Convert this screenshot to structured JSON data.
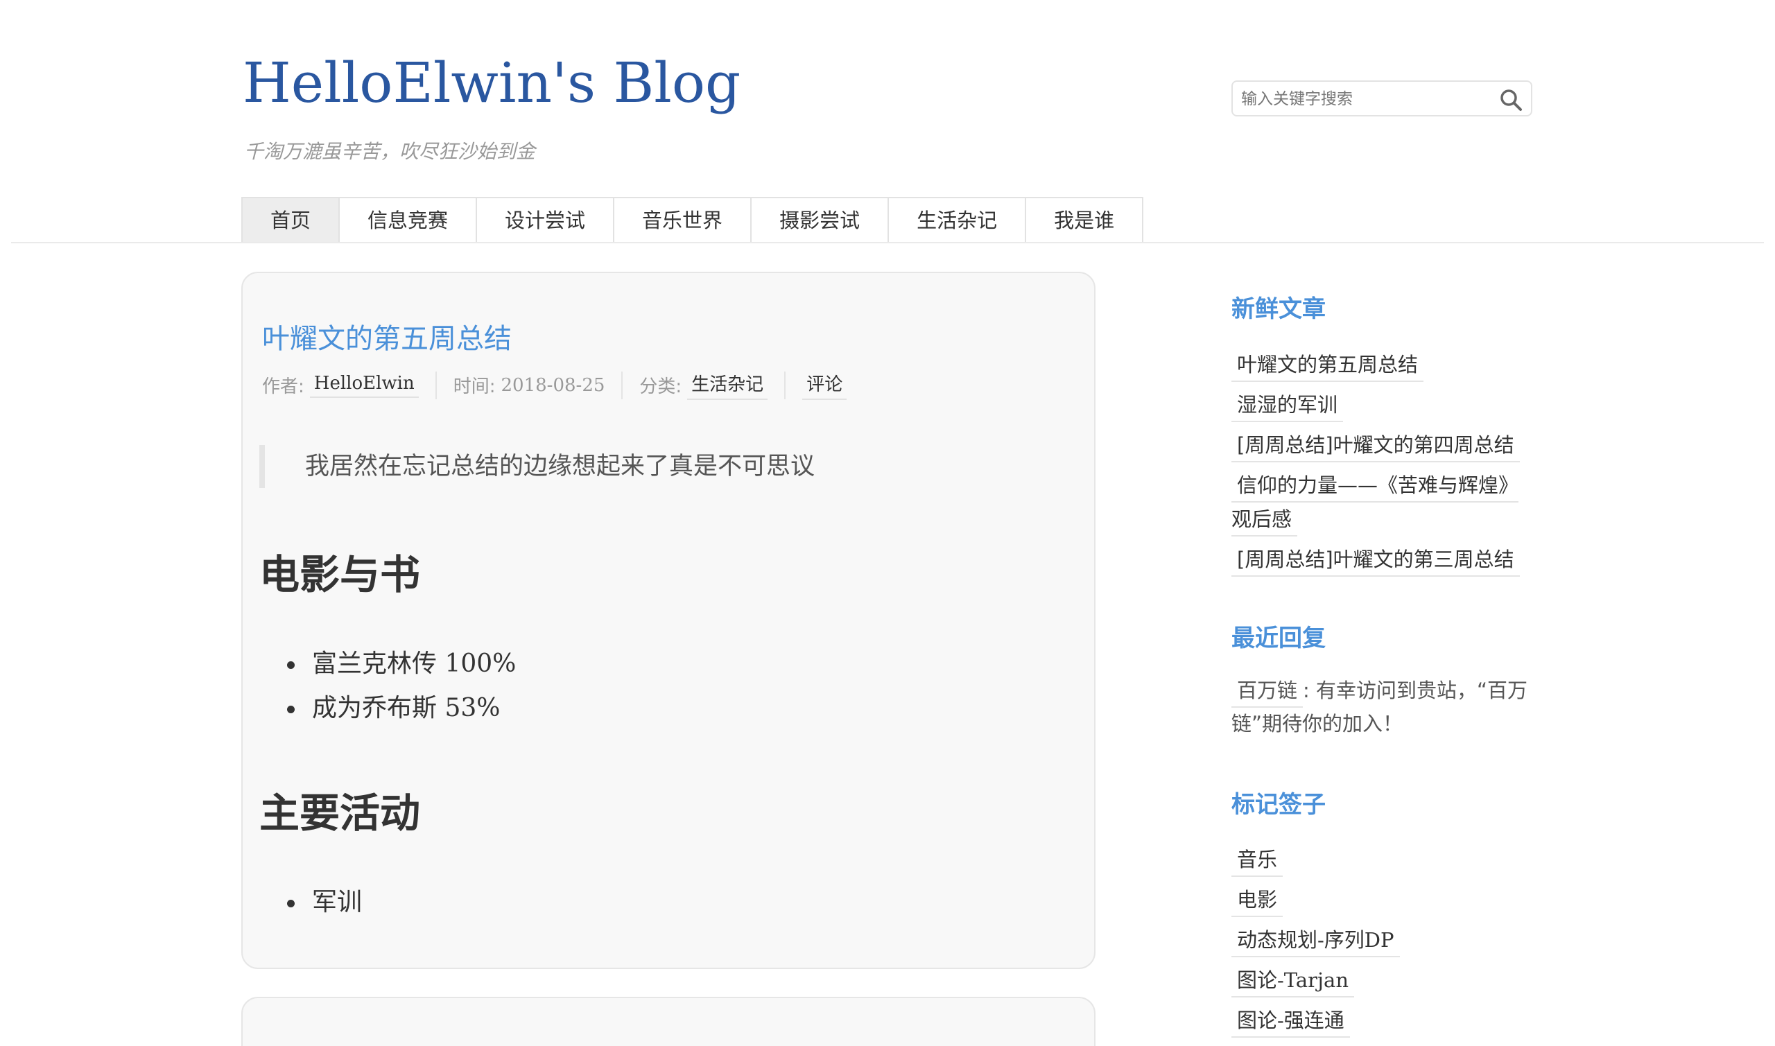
{
  "site": {
    "title": "HelloElwin's Blog",
    "description": "千淘万漉虽辛苦，吹尽狂沙始到金"
  },
  "search": {
    "placeholder": "输入关键字搜索",
    "icon": "search-icon"
  },
  "nav": {
    "items": [
      "首页",
      "信息竞赛",
      "设计尝试",
      "音乐世界",
      "摄影尝试",
      "生活杂记",
      "我是谁"
    ],
    "active": "首页"
  },
  "post": {
    "title": "叶耀文的第五周总结",
    "meta": {
      "author_label": "作者:",
      "author": "HelloElwin",
      "time_label": "时间:",
      "time": "2018-08-25",
      "category_label": "分类:",
      "category": "生活杂记",
      "comments": "评论"
    },
    "quote": "我居然在忘记总结的边缘想起来了真是不可思议",
    "sections": [
      {
        "heading": "电影与书",
        "items": [
          {
            "text": "富兰克林传",
            "num": "100%"
          },
          {
            "text": "成为乔布斯",
            "num": "53%"
          }
        ]
      },
      {
        "heading": "主要活动",
        "items": [
          {
            "text": "军训",
            "num": ""
          }
        ]
      }
    ]
  },
  "sidebar": {
    "recent_posts": {
      "title": "新鲜文章",
      "items": [
        "叶耀文的第五周总结",
        "湿湿的军训",
        "[周周总结]叶耀文的第四周总结",
        "信仰的力量——《苦难与辉煌》观后感",
        "[周周总结]叶耀文的第三周总结"
      ]
    },
    "recent_comments": {
      "title": "最近回复",
      "author": "百万链",
      "text": ": 有幸访问到贵站，“百万链”期待你的加入！"
    },
    "tags": {
      "title": "标记签子",
      "items": [
        "音乐",
        "电影",
        "动态规划-序列DP",
        "图论-Tarjan",
        "图论-强连通"
      ]
    }
  },
  "colors": {
    "site_title": "#2a57a0",
    "accent": "#4a90d9",
    "card_bg": "#f8f8f8",
    "nav_active_bg": "#ededed"
  }
}
